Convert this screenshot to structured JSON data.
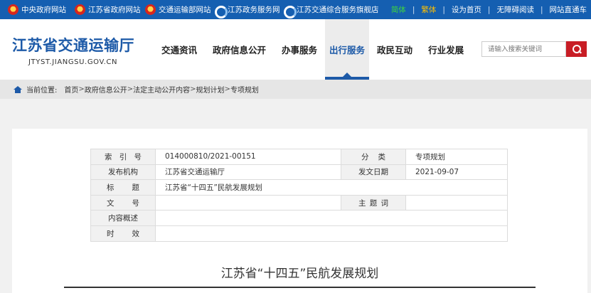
{
  "topbar": {
    "links": [
      {
        "label": "中央政府网站",
        "icon": "national-emblem-icon"
      },
      {
        "label": "江苏省政府网站",
        "icon": "national-emblem-icon"
      },
      {
        "label": "交通运输部网站",
        "icon": "national-emblem-icon"
      },
      {
        "label": "江苏政务服务网",
        "icon": "government-service-icon"
      },
      {
        "label": "江苏交通综合服务旗舰店",
        "icon": "government-service-icon"
      }
    ],
    "right": {
      "simplified": "简体",
      "traditional": "繁体",
      "set_home": "设为首页",
      "accessibility": "无障碍阅读",
      "express": "网站直通车"
    }
  },
  "header": {
    "title": "江苏省交通运输厅",
    "subtitle": "JTYST.JIANGSU.GOV.CN",
    "nav": [
      {
        "label": "交通资讯",
        "active": false
      },
      {
        "label": "政府信息公开",
        "active": false
      },
      {
        "label": "办事服务",
        "active": false
      },
      {
        "label": "出行服务",
        "active": true
      },
      {
        "label": "政民互动",
        "active": false
      },
      {
        "label": "行业发展",
        "active": false
      }
    ],
    "search_placeholder": "请输入搜索关键词"
  },
  "breadcrumb": {
    "label": "当前位置:",
    "items": [
      "首页",
      "政府信息公开",
      "法定主动公开内容",
      "规划计划",
      "专项规划"
    ],
    "separator": ">"
  },
  "meta": {
    "index_label": "索引号",
    "index_value": "014000810/2021-00151",
    "category_label": "分类",
    "category_value": "专项规划",
    "issuer_label": "发布机构",
    "issuer_value": "江苏省交通运输厅",
    "date_label": "发文日期",
    "date_value": "2021-09-07",
    "title_label": "标题",
    "title_value": "江苏省“十四五”民航发展规划",
    "docno_label": "文号",
    "docno_value": "",
    "subject_label": "主题词",
    "subject_value": "",
    "summary_label": "内容概述",
    "summary_value": "",
    "validity_label": "时效",
    "validity_value": ""
  },
  "article": {
    "title": "江苏省“十四五”民航发展规划"
  },
  "colors": {
    "topbar": "#155fb1",
    "brand": "#1d5aa8",
    "search_button": "#c81d25",
    "simplified": "#3ed53e",
    "traditional": "#ffc000"
  }
}
